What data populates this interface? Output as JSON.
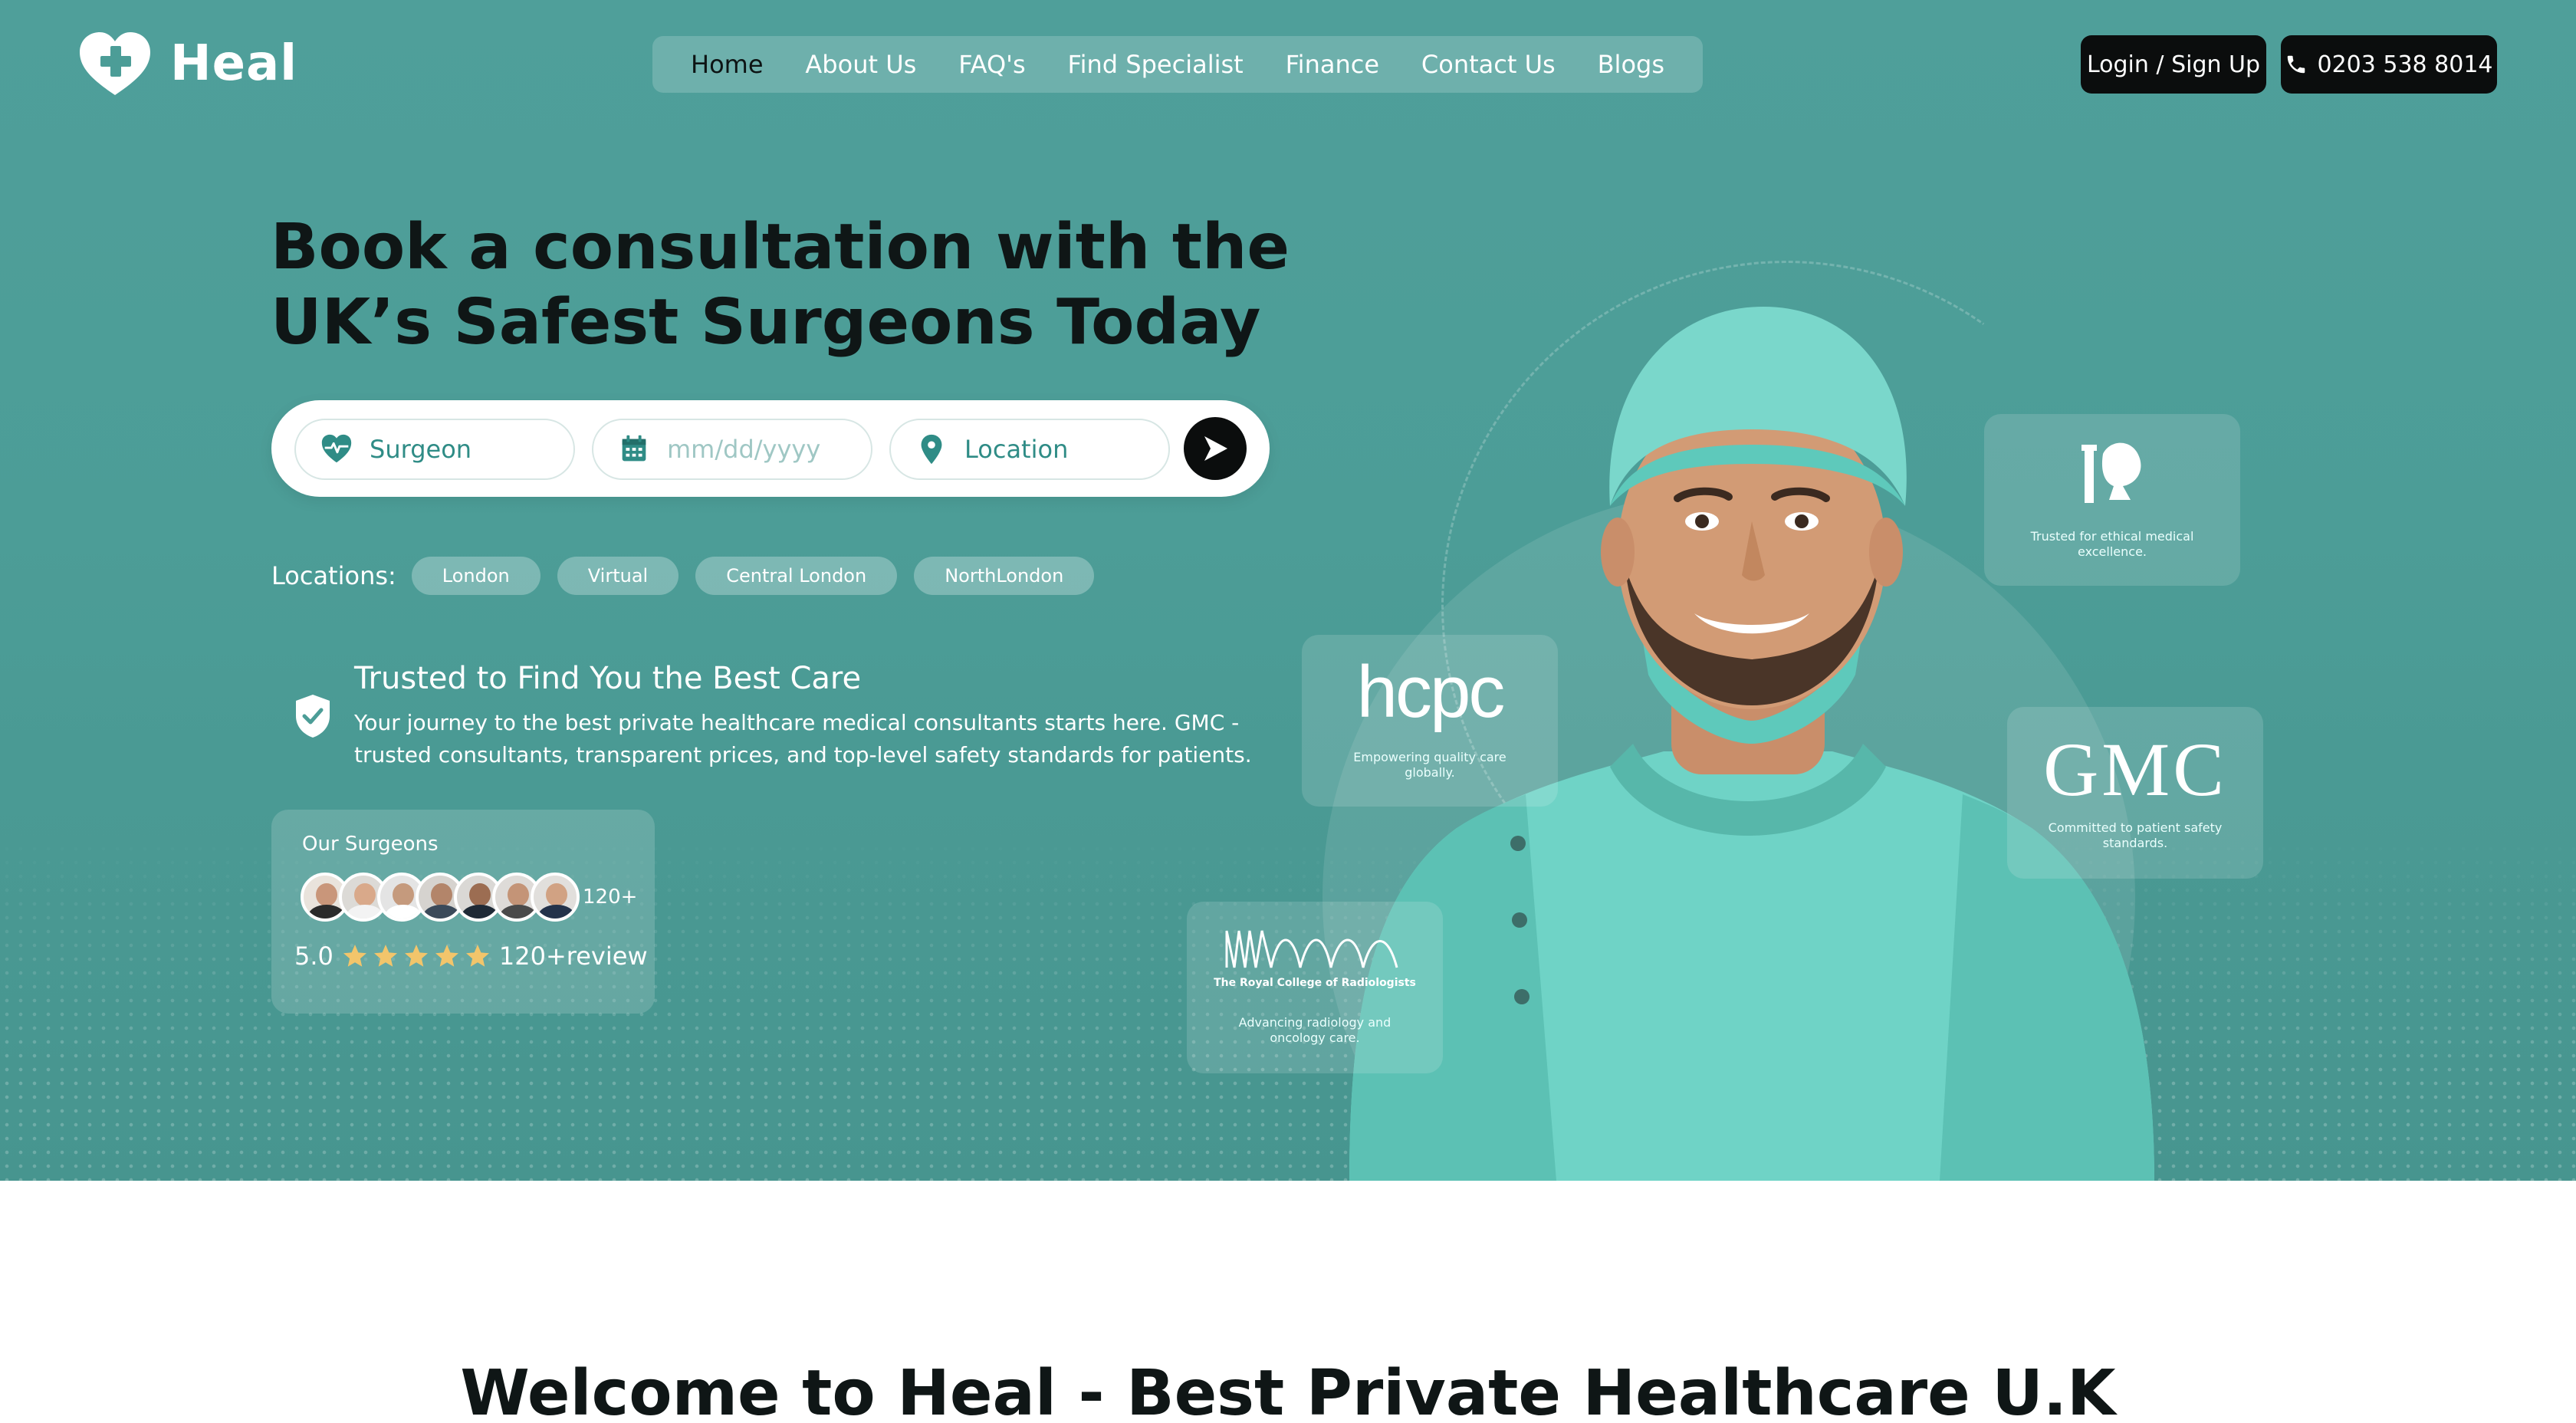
{
  "brand": {
    "name": "Heal"
  },
  "nav": {
    "items": [
      {
        "label": "Home",
        "active": true
      },
      {
        "label": "About Us",
        "active": false
      },
      {
        "label": "FAQ's",
        "active": false
      },
      {
        "label": "Find Specialist",
        "active": false
      },
      {
        "label": "Finance",
        "active": false
      },
      {
        "label": "Contact Us",
        "active": false
      },
      {
        "label": "Blogs",
        "active": false
      }
    ],
    "login_label": "Login / Sign Up",
    "phone_label": "0203 538 8014"
  },
  "hero": {
    "headline_line1": "Book a consultation with the",
    "headline_line2": "UK’s Safest Surgeons Today"
  },
  "search": {
    "specialty_value": "Surgeon",
    "date_placeholder": "mm/dd/yyyy",
    "location_value": "Location",
    "icons": [
      "heart-pulse-icon",
      "calendar-icon",
      "map-pin-icon",
      "arrow-right-icon"
    ]
  },
  "locations": {
    "label": "Locations:",
    "items": [
      "London",
      "Virtual",
      "Central London",
      "NorthLondon"
    ]
  },
  "trust": {
    "title": "Trusted to Find You the Best Care",
    "description": "Your journey to the best private healthcare medical consultants starts here. GMC - trusted consultants, transparent prices, and top-level safety standards for patients."
  },
  "surgeons": {
    "title": "Our Surgeons",
    "count": "120+",
    "rating": "5.0",
    "stars": 5,
    "reviews": "120+review"
  },
  "accreditations": [
    {
      "name": "crest",
      "caption": "Trusted for ethical medical excellence."
    },
    {
      "name": "hcpc",
      "caption": "Empowering quality care globally."
    },
    {
      "name": "GMC",
      "caption": "Committed to patient safety standards."
    },
    {
      "name": "The Royal College of Radiologists",
      "caption": "Advancing radiology and oncology care."
    }
  ],
  "welcome": {
    "title": "Welcome to Heal - Best Private Healthcare U.K"
  },
  "colors": {
    "hero_bg": "#4c9d97",
    "accent": "#2f8c86",
    "dark": "#0b0d0d",
    "star": "#f2c56b",
    "scrubs": "#6fd3c6"
  }
}
